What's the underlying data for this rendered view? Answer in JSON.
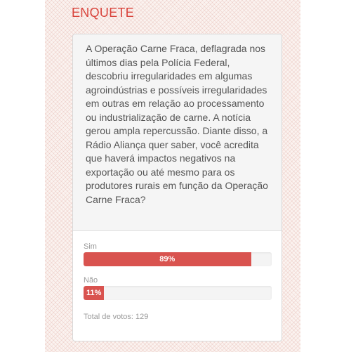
{
  "poll": {
    "title": "ENQUETE",
    "question": "A Operação Carne Fraca, deflagrada nos últimos dias pela Polícia Federal, descobriu irregularidades em algumas agroindústrias e possíveis irregularidades em outras em relação ao processamento ou industrialização de carne. A notícia gerou ampla repercussão. Diante disso, a Rádio Aliança quer saber, você acredita que haverá impactos negativos na exportação ou até mesmo para os produtores rurais em função da Operação Carne Fraca?",
    "options": [
      {
        "label": "Sim",
        "percent": 89,
        "percent_label": "89%"
      },
      {
        "label": "Não",
        "percent": 11,
        "percent_label": "11%"
      }
    ],
    "total_votes": "Total de votos: 129"
  },
  "colors": {
    "accent": "#d9443c",
    "bar_fill": "#d9534f"
  }
}
